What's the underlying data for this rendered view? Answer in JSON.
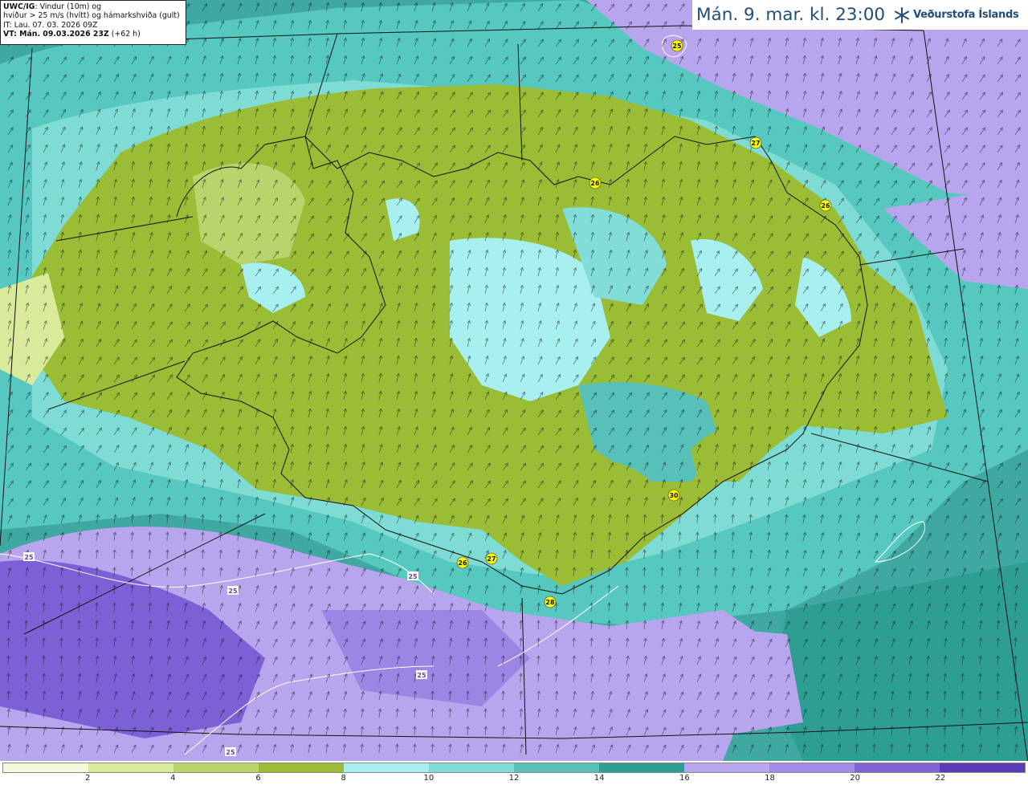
{
  "info": {
    "model": "UWC/IG",
    "line1_rest": ": Vindur (10m) og",
    "line2": "hviður > 25 m/s (hvítt) og hámarkshviða (gult)",
    "line3": "IT: Lau. 07. 03. 2026 09Z",
    "line4": "VT: Mán. 09.03.2026 23Z",
    "line4_extra": "(+62 h)"
  },
  "title": "Mán. 9. mar. kl. 23:00",
  "logo": {
    "icon": "snowflake-icon",
    "text": "Veðurstofa Íslands"
  },
  "gust_labels": [
    "25",
    "27",
    "26",
    "26",
    "30",
    "26",
    "27",
    "28",
    "25",
    "25",
    "25",
    "25",
    "25"
  ],
  "legend": {
    "colors": [
      "#f4f9dc",
      "#d9eb9a",
      "#b9d46a",
      "#9bbd36",
      "#a8f0f0",
      "#82dcd8",
      "#56c0b9",
      "#2e9e93",
      "#b8a6ee",
      "#a08ae6",
      "#8064d8",
      "#5a3cb4"
    ],
    "ticks": [
      "2",
      "4",
      "6",
      "8",
      "10",
      "12",
      "14",
      "16",
      "18",
      "20",
      "22"
    ]
  }
}
